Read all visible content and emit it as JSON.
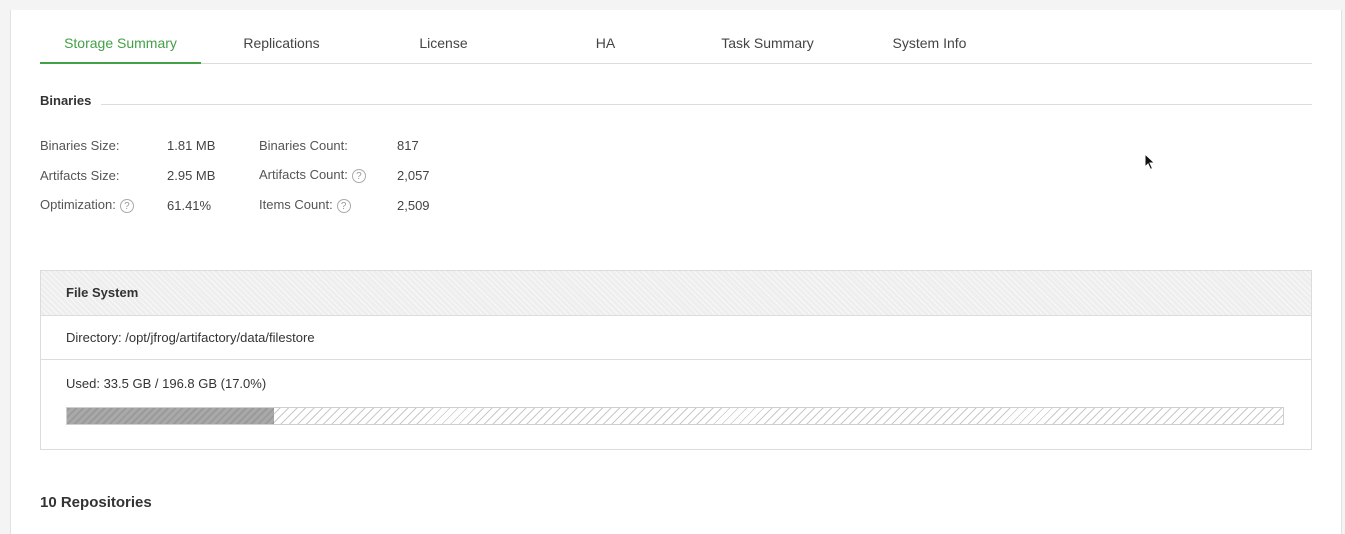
{
  "tabs": [
    {
      "label": "Storage Summary",
      "active": true
    },
    {
      "label": "Replications",
      "active": false
    },
    {
      "label": "License",
      "active": false
    },
    {
      "label": "HA",
      "active": false
    },
    {
      "label": "Task Summary",
      "active": false
    },
    {
      "label": "System Info",
      "active": false
    }
  ],
  "binaries": {
    "title": "Binaries",
    "binaries_size_label": "Binaries Size:",
    "binaries_size": "1.81 MB",
    "artifacts_size_label": "Artifacts Size:",
    "artifacts_size": "2.95 MB",
    "optimization_label": "Optimization:",
    "optimization": "61.41%",
    "binaries_count_label": "Binaries Count:",
    "binaries_count": "817",
    "artifacts_count_label": "Artifacts Count:",
    "artifacts_count": "2,057",
    "items_count_label": "Items Count:",
    "items_count": "2,509",
    "help_glyph": "?"
  },
  "file_system": {
    "title": "File System",
    "directory": "Directory: /opt/jfrog/artifactory/data/filestore",
    "used": "Used: 33.5 GB / 196.8 GB (17.0%)",
    "used_percent": 17.0
  },
  "repositories": {
    "title": "10 Repositories"
  },
  "colors": {
    "accent": "#43a047"
  },
  "icons": {
    "help": "help-circle-icon",
    "cursor": "mouse-pointer-icon"
  }
}
